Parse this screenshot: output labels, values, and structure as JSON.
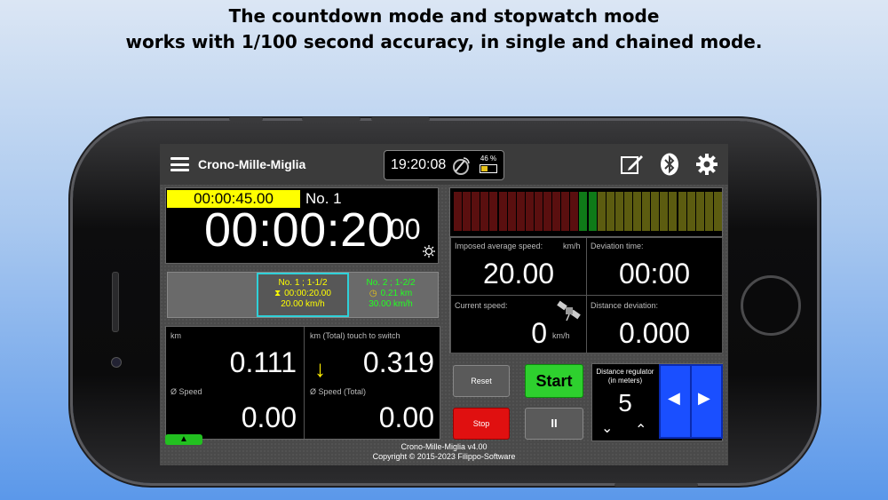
{
  "headline": {
    "line1": "The countdown mode and stopwatch mode",
    "line2": "works with 1/100 second accuracy, in single and chained mode."
  },
  "app": {
    "title": "Crono-Mille-Miglia",
    "clock": "19:20:08",
    "battery_percent": "46 %",
    "battery_level": 0.46
  },
  "timer": {
    "countdown": "00:00:45.00",
    "number": "No. 1",
    "elapsed": "00:00:20",
    "hundredths": "00"
  },
  "laps": {
    "lap1": {
      "title": "No. 1 ; 1-1/2",
      "time": "00:00:20.00",
      "speed": "20.00 km/h"
    },
    "lap2": {
      "title": "No. 2 ; 1-2/2",
      "distance": "0.21 km",
      "speed": "30.00 km/h"
    }
  },
  "odometer": {
    "km_label": "km",
    "km_value": "0.111",
    "km_total_label": "km (Total) touch to switch",
    "km_total_value": "0.319",
    "speed_label": "Ø Speed",
    "speed_value": "0.00",
    "speed_total_label": "Ø Speed (Total)",
    "speed_total_value": "0.00"
  },
  "deviation_bar": {
    "segments": 30,
    "red_count": 14,
    "green_index": 14,
    "colors": {
      "red": "#5a0f0f",
      "green": "#0f7a18",
      "olive": "#5c5c10"
    }
  },
  "stats": {
    "imposed_label": "Imposed average speed:",
    "imposed_unit": "km/h",
    "imposed_value": "20.00",
    "deviation_time_label": "Deviation time:",
    "deviation_time_value": "00:00",
    "current_speed_label": "Current speed:",
    "current_speed_value": "0",
    "current_speed_unit": "km/h",
    "distance_deviation_label": "Distance deviation:",
    "distance_deviation_value": "0.000"
  },
  "controls": {
    "reset": "Reset",
    "start": "Start",
    "stop": "Stop",
    "pause": "II"
  },
  "regulator": {
    "label_line1": "Distance regulator",
    "label_line2": "(in meters)",
    "value": "5"
  },
  "footer": {
    "version": "Crono-Mille-Miglia v4.00",
    "copyright": "Copyright © 2015-2023 Filippo-Software"
  },
  "icons": [
    "menu-icon",
    "satellite-icon",
    "battery-icon",
    "edit-icon",
    "bluetooth-icon",
    "gear-icon",
    "sun-icon",
    "hourglass-icon",
    "clock-icon",
    "arrow-down-icon",
    "arrow-up-icon",
    "chevron-down-icon",
    "chevron-up-icon",
    "arrow-left-icon",
    "arrow-right-icon"
  ]
}
